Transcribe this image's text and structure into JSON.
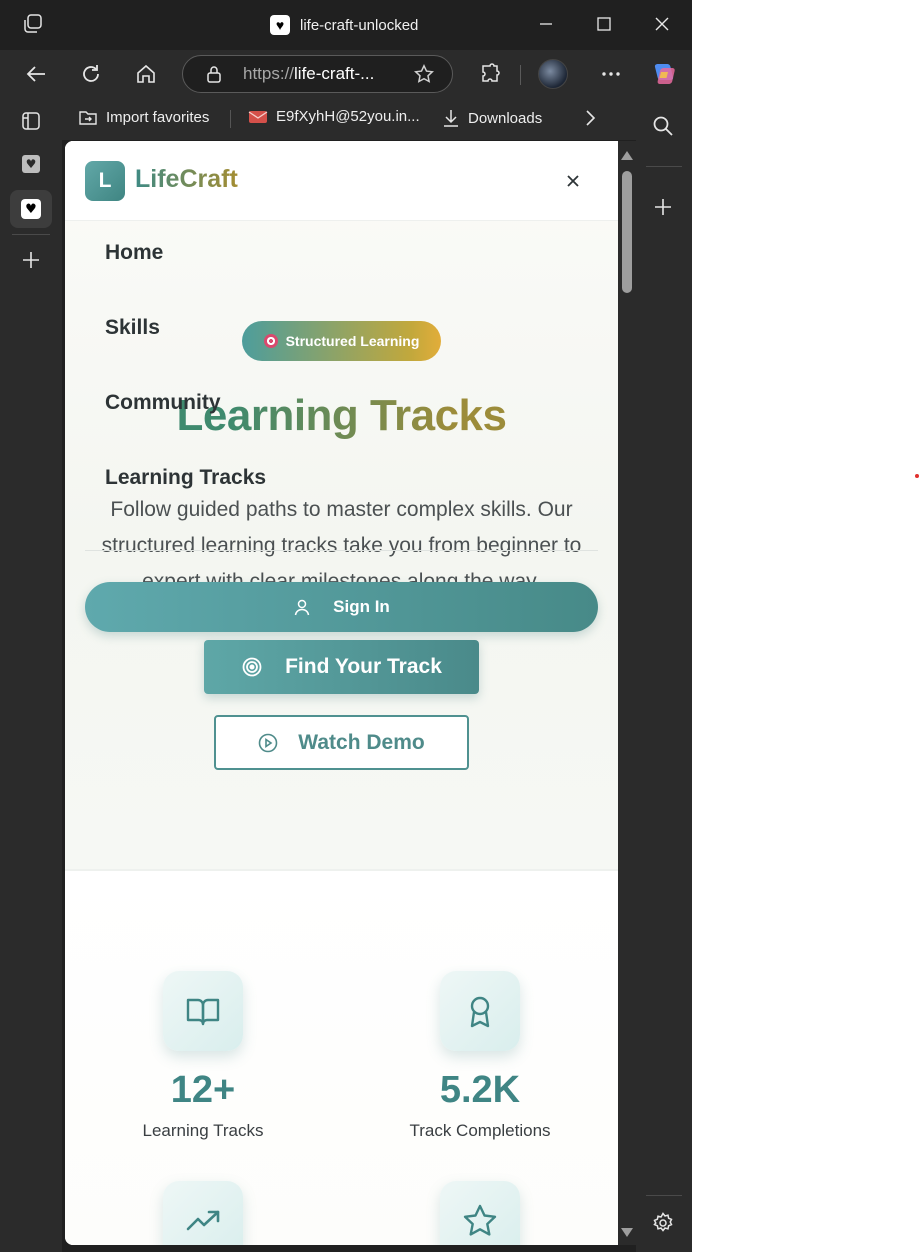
{
  "browser": {
    "tab_title": "life-craft-unlocked",
    "url_prefix": "https://",
    "url_rest": "life-craft-...",
    "favorites": [
      {
        "label": "Import favorites"
      },
      {
        "label": "E9fXyhH@52you.in..."
      },
      {
        "label": "Downloads"
      }
    ]
  },
  "site": {
    "logo_letter": "L",
    "logo_text": "LifeCraft",
    "nav": [
      "Home",
      "Skills",
      "Community",
      "Learning Tracks"
    ],
    "badge": "Structured Learning",
    "hero_title": "Learning Tracks",
    "hero_description": "Follow guided paths to master complex skills. Our structured learning tracks take you from beginner to expert with clear milestones along the way.",
    "signin_label": "Sign In",
    "find_track_label": "Find Your Track",
    "watch_demo_label": "Watch Demo",
    "stats": [
      {
        "value": "12+",
        "label": "Learning Tracks",
        "icon": "book-open-icon"
      },
      {
        "value": "5.2K",
        "label": "Track Completions",
        "icon": "award-icon"
      },
      {
        "value": "",
        "label": "",
        "icon": "trending-up-icon"
      },
      {
        "value": "",
        "label": "",
        "icon": "star-icon"
      }
    ]
  },
  "colors": {
    "brand_teal": "#4f9190",
    "brand_gold": "#a48d32",
    "browser_dark": "#202020"
  }
}
